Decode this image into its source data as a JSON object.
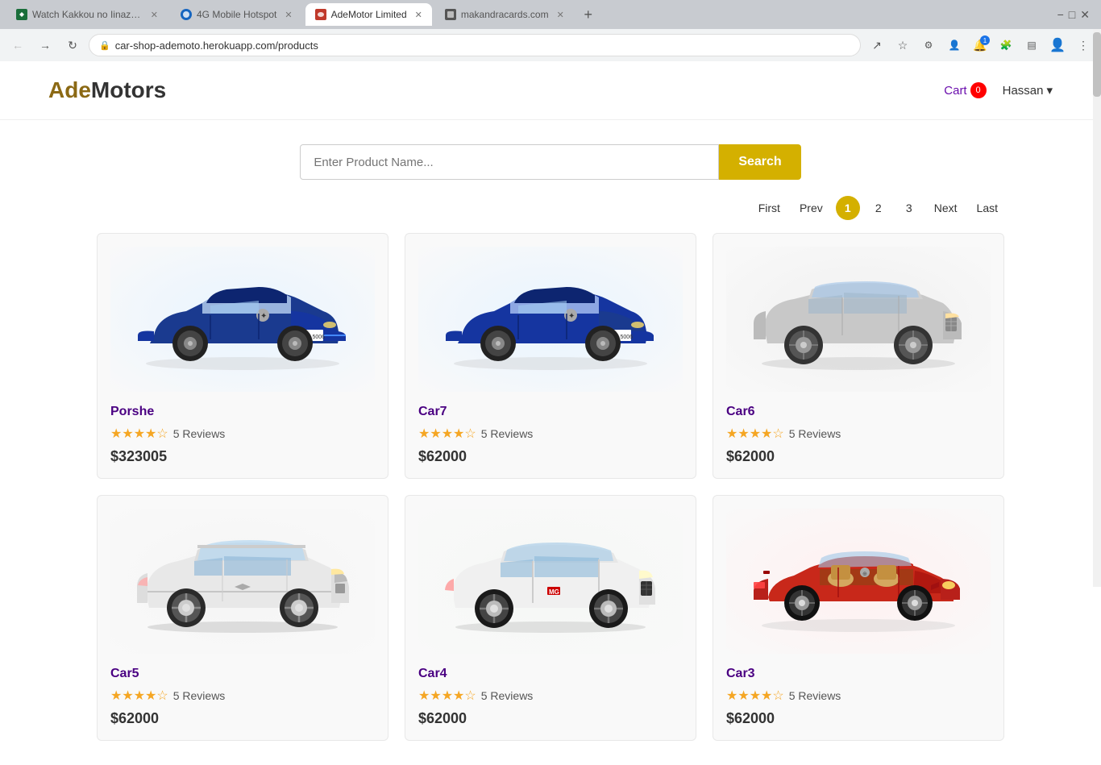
{
  "browser": {
    "url": "car-shop-ademoto.herokuapp.com/products",
    "tabs": [
      {
        "label": "Watch Kakkou no Iinazuke Episo...",
        "favicon_color": "#1a6e3a",
        "active": false
      },
      {
        "label": "4G Mobile Hotspot",
        "favicon_color": "#1565c0",
        "active": false
      },
      {
        "label": "AdeMotor Limited",
        "favicon_color": "#c0392b",
        "active": true
      },
      {
        "label": "makandracards.com",
        "favicon_color": "#555",
        "active": false
      }
    ]
  },
  "header": {
    "logo_ade": "Ade",
    "logo_motors": "Motors",
    "cart_label": "Cart",
    "cart_count": "0",
    "user_label": "Hassan",
    "user_chevron": "▾"
  },
  "search": {
    "placeholder": "Enter Product Name...",
    "button_label": "Search"
  },
  "pagination": {
    "first_label": "First",
    "prev_label": "Prev",
    "pages": [
      "1",
      "2",
      "3"
    ],
    "active_page": "1",
    "next_label": "Next",
    "last_label": "Last"
  },
  "products": [
    {
      "id": 1,
      "name": "Porshe",
      "reviews_count": "5 Reviews",
      "stars": 4,
      "price": "$323005",
      "car_type": "blue-convertible",
      "car_color": "#1a3a8f"
    },
    {
      "id": 2,
      "name": "Car7",
      "reviews_count": "5 Reviews",
      "stars": 4,
      "price": "$62000",
      "car_type": "blue-convertible",
      "car_color": "#1a3a8f"
    },
    {
      "id": 3,
      "name": "Car6",
      "reviews_count": "5 Reviews",
      "stars": 4,
      "price": "$62000",
      "car_type": "silver-suv",
      "car_color": "#888"
    },
    {
      "id": 4,
      "name": "Car5",
      "reviews_count": "5 Reviews",
      "stars": 4,
      "price": "$62000",
      "car_type": "white-suv",
      "car_color": "#ddd"
    },
    {
      "id": 5,
      "name": "Car4",
      "reviews_count": "5 Reviews",
      "stars": 4,
      "price": "$62000",
      "car_type": "white-suv2",
      "car_color": "#ddd"
    },
    {
      "id": 6,
      "name": "Car3",
      "reviews_count": "5 Reviews",
      "stars": 4,
      "price": "$62000",
      "car_type": "red-car",
      "car_color": "#c0392b"
    }
  ],
  "icons": {
    "back": "←",
    "forward": "→",
    "refresh": "↻",
    "lock": "🔒",
    "star_full": "★",
    "star_empty": "☆",
    "chevron_down": "▾"
  }
}
